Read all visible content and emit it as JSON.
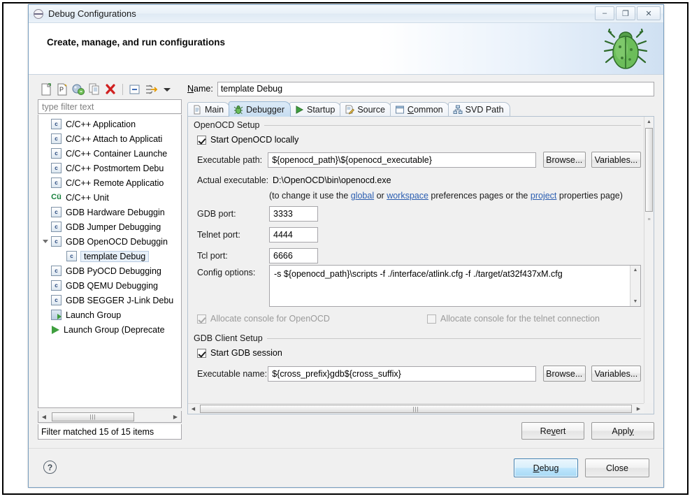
{
  "window": {
    "title": "Debug Configurations",
    "icon": "eclipse-debug-icon",
    "buttons": {
      "minimize": "–",
      "maximize": "❐",
      "close": "✕"
    }
  },
  "banner": {
    "title": "Create, manage, and run configurations",
    "icon": "green-bug-icon"
  },
  "left_panel": {
    "toolbar": [
      {
        "name": "new-launch-configuration-icon",
        "glyph": "new-config"
      },
      {
        "name": "new-prototype-icon",
        "glyph": "new-prototype"
      },
      {
        "name": "export-icon",
        "glyph": "export"
      },
      {
        "name": "duplicate-icon",
        "glyph": "duplicate"
      },
      {
        "name": "delete-icon",
        "glyph": "delete"
      },
      {
        "name": "collapse-all-icon",
        "glyph": "collapse"
      },
      {
        "name": "filter-icon",
        "glyph": "filter"
      },
      {
        "name": "view-menu-icon",
        "glyph": "menu-arrow"
      }
    ],
    "filter": {
      "placeholder": "type filter text",
      "value": ""
    },
    "tree": [
      {
        "label": "C/C++ Application",
        "icon": "c-config-icon",
        "indent": 0,
        "expander": "",
        "selected": false
      },
      {
        "label": "C/C++ Attach to Applicati",
        "icon": "c-config-icon",
        "indent": 0,
        "expander": "",
        "selected": false
      },
      {
        "label": "C/C++ Container Launche",
        "icon": "c-config-icon",
        "indent": 0,
        "expander": "",
        "selected": false
      },
      {
        "label": "C/C++ Postmortem Debu",
        "icon": "c-config-icon",
        "indent": 0,
        "expander": "",
        "selected": false
      },
      {
        "label": "C/C++ Remote Applicatio",
        "icon": "c-config-icon",
        "indent": 0,
        "expander": "",
        "selected": false
      },
      {
        "label": "C/C++ Unit",
        "icon": "cunit-icon",
        "indent": 0,
        "expander": "",
        "selected": false
      },
      {
        "label": "GDB Hardware Debuggin",
        "icon": "c-config-icon",
        "indent": 0,
        "expander": "",
        "selected": false
      },
      {
        "label": "GDB Jumper Debugging",
        "icon": "c-config-icon",
        "indent": 0,
        "expander": "",
        "selected": false
      },
      {
        "label": "GDB OpenOCD Debuggin",
        "icon": "c-config-icon",
        "indent": 0,
        "expander": "expanded",
        "selected": false
      },
      {
        "label": "template Debug",
        "icon": "c-config-icon",
        "indent": 1,
        "expander": "",
        "selected": true
      },
      {
        "label": "GDB PyOCD Debugging",
        "icon": "c-config-icon",
        "indent": 0,
        "expander": "",
        "selected": false
      },
      {
        "label": "GDB QEMU Debugging",
        "icon": "c-config-icon",
        "indent": 0,
        "expander": "",
        "selected": false
      },
      {
        "label": "GDB SEGGER J-Link Debu",
        "icon": "c-config-icon",
        "indent": 0,
        "expander": "",
        "selected": false
      },
      {
        "label": "Launch Group",
        "icon": "launch-group-icon",
        "indent": 0,
        "expander": "",
        "selected": false
      },
      {
        "label": "Launch Group (Deprecate",
        "icon": "launch-group-deprecated-icon",
        "indent": 0,
        "expander": "",
        "selected": false
      }
    ],
    "status": "Filter matched 15 of 15 items"
  },
  "right_panel": {
    "name_label": "Name:",
    "name_value": "template Debug",
    "tabs": [
      {
        "label": "Main",
        "icon": "main-tab-icon",
        "active": false
      },
      {
        "label": "Debugger",
        "icon": "debugger-tab-icon",
        "active": true
      },
      {
        "label": "Startup",
        "icon": "startup-tab-icon",
        "active": false
      },
      {
        "label": "Source",
        "icon": "source-tab-icon",
        "active": false
      },
      {
        "label": "Common",
        "icon": "common-tab-icon",
        "active": false
      },
      {
        "label": "SVD Path",
        "icon": "svd-path-tab-icon",
        "active": false
      }
    ],
    "openocd_setup": {
      "group_title": "OpenOCD Setup",
      "start_locally_label": "Start OpenOCD locally",
      "start_locally_checked": true,
      "executable_path_label": "Executable path:",
      "executable_path_value": "${openocd_path}\\${openocd_executable}",
      "browse_label": "Browse...",
      "variables_label": "Variables...",
      "actual_executable_label": "Actual executable:",
      "actual_executable_value": "D:\\OpenOCD\\bin\\openocd.exe",
      "hint_prefix": "(to change it use the ",
      "hint_link_global": "global",
      "hint_mid1": " or ",
      "hint_link_workspace": "workspace",
      "hint_mid2": " preferences pages or the ",
      "hint_link_project": "project",
      "hint_suffix": " properties page)",
      "gdb_port_label": "GDB port:",
      "gdb_port_value": "3333",
      "telnet_port_label": "Telnet port:",
      "telnet_port_value": "4444",
      "tcl_port_label": "Tcl port:",
      "tcl_port_value": "6666",
      "config_options_label": "Config options:",
      "config_options_value": "-s ${openocd_path}\\scripts -f ./interface/atlink.cfg -f ./target/at32f437xM.cfg",
      "allocate_openocd_label": "Allocate console for OpenOCD",
      "allocate_openocd_checked": true,
      "allocate_telnet_label": "Allocate console for the telnet connection",
      "allocate_telnet_checked": false
    },
    "gdb_client_setup": {
      "group_title": "GDB Client Setup",
      "start_session_label": "Start GDB session",
      "start_session_checked": true,
      "executable_name_label": "Executable name:",
      "executable_name_value": "${cross_prefix}gdb${cross_suffix}",
      "browse_label": "Browse...",
      "variables_label": "Variables..."
    },
    "revert_label": "Revert",
    "apply_label": "Apply"
  },
  "footer": {
    "help_icon": "help-question-icon",
    "debug_label": "Debug",
    "close_label": "Close"
  },
  "colors": {
    "accent": "#3c7fb1",
    "link": "#2a5db0",
    "tab_active": "#c6dcf0",
    "bug_green": "#5aa84f"
  }
}
